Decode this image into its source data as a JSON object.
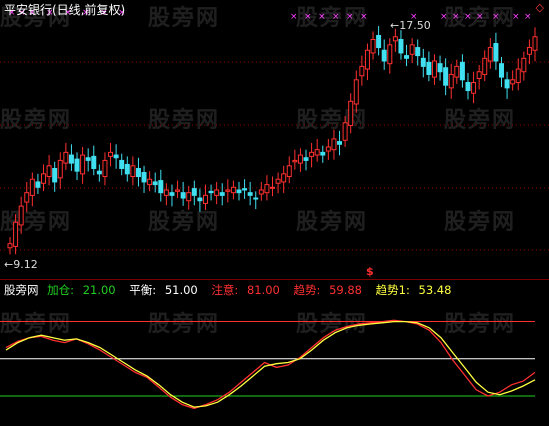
{
  "header": {
    "title": "平安银行(日线,前复权)",
    "corner_symbol": "◇"
  },
  "annotations": {
    "high_price": "17.50",
    "low_price": "9.12",
    "signal_mark": "$"
  },
  "watermark": "股旁网",
  "indicator": {
    "name": "股旁网",
    "items": [
      {
        "label": "加仓: ",
        "value": "21.00",
        "color": "#20d020"
      },
      {
        "label": "平衡: ",
        "value": "51.00",
        "color": "#ffffff"
      },
      {
        "label": "注意: ",
        "value": "81.00",
        "color": "#ff3030"
      },
      {
        "label": "趋势: ",
        "value": "59.88",
        "color": "#ff3030"
      },
      {
        "label": "趋势1: ",
        "value": "53.48",
        "color": "#ffff40"
      }
    ]
  },
  "colors": {
    "up": "#ff3030",
    "down": "#40e0f0",
    "grid": "#8b0000",
    "marker": "#ff40ff",
    "trend": "#ff3030",
    "trend1": "#ffff40",
    "line_attention": "#ff3030",
    "line_balance": "#ffffff",
    "line_add": "#20d020"
  },
  "chart_data": {
    "type": "candlestick",
    "price_low": 9.12,
    "price_high": 17.5,
    "closes": [
      9.5,
      10.3,
      10.9,
      11.4,
      11.9,
      11.6,
      12.1,
      12.4,
      11.8,
      12.6,
      12.9,
      12.5,
      12.2,
      12.8,
      12.6,
      12.3,
      12.1,
      12.6,
      12.9,
      12.7,
      12.3,
      12.1,
      12.4,
      12.0,
      11.8,
      11.9,
      11.7,
      11.4,
      11.5,
      11.3,
      11.5,
      11.2,
      11.4,
      11.3,
      11.1,
      11.3,
      11.4,
      11.5,
      11.3,
      11.5,
      11.6,
      11.4,
      11.5,
      11.3,
      11.2,
      11.5,
      11.7,
      11.6,
      11.9,
      12.1,
      12.4,
      12.6,
      12.8,
      12.6,
      12.9,
      13.0,
      12.8,
      13.1,
      13.4,
      13.2,
      14.0,
      14.8,
      15.6,
      16.1,
      16.7,
      17.1,
      16.8,
      16.3,
      16.9,
      17.2,
      16.6,
      16.4,
      16.9,
      16.5,
      16.1,
      15.8,
      16.3,
      15.9,
      15.4,
      15.8,
      16.1,
      15.6,
      15.2,
      15.5,
      15.9,
      16.4,
      16.8,
      16.3,
      15.7,
      15.3,
      15.6,
      16.0,
      16.4,
      16.8,
      17.2
    ],
    "trend": [
      60,
      65,
      68,
      69,
      66,
      64,
      67,
      63,
      58,
      52,
      46,
      40,
      36,
      28,
      20,
      14,
      11,
      14,
      18,
      24,
      32,
      40,
      48,
      44,
      46,
      52,
      60,
      68,
      74,
      77,
      79,
      80,
      81,
      82,
      81,
      79,
      74,
      64,
      50,
      38,
      26,
      21,
      24,
      30,
      33,
      40
    ],
    "trend1": [
      58,
      64,
      68,
      70,
      68,
      66,
      67,
      64,
      60,
      54,
      48,
      42,
      37,
      30,
      22,
      16,
      12,
      13,
      16,
      22,
      29,
      37,
      45,
      47,
      48,
      51,
      58,
      66,
      72,
      76,
      78,
      79,
      80,
      81,
      81,
      80,
      76,
      68,
      56,
      44,
      32,
      24,
      22,
      25,
      29,
      34
    ],
    "levels": {
      "attention": 81,
      "balance": 51,
      "add": 21
    }
  }
}
